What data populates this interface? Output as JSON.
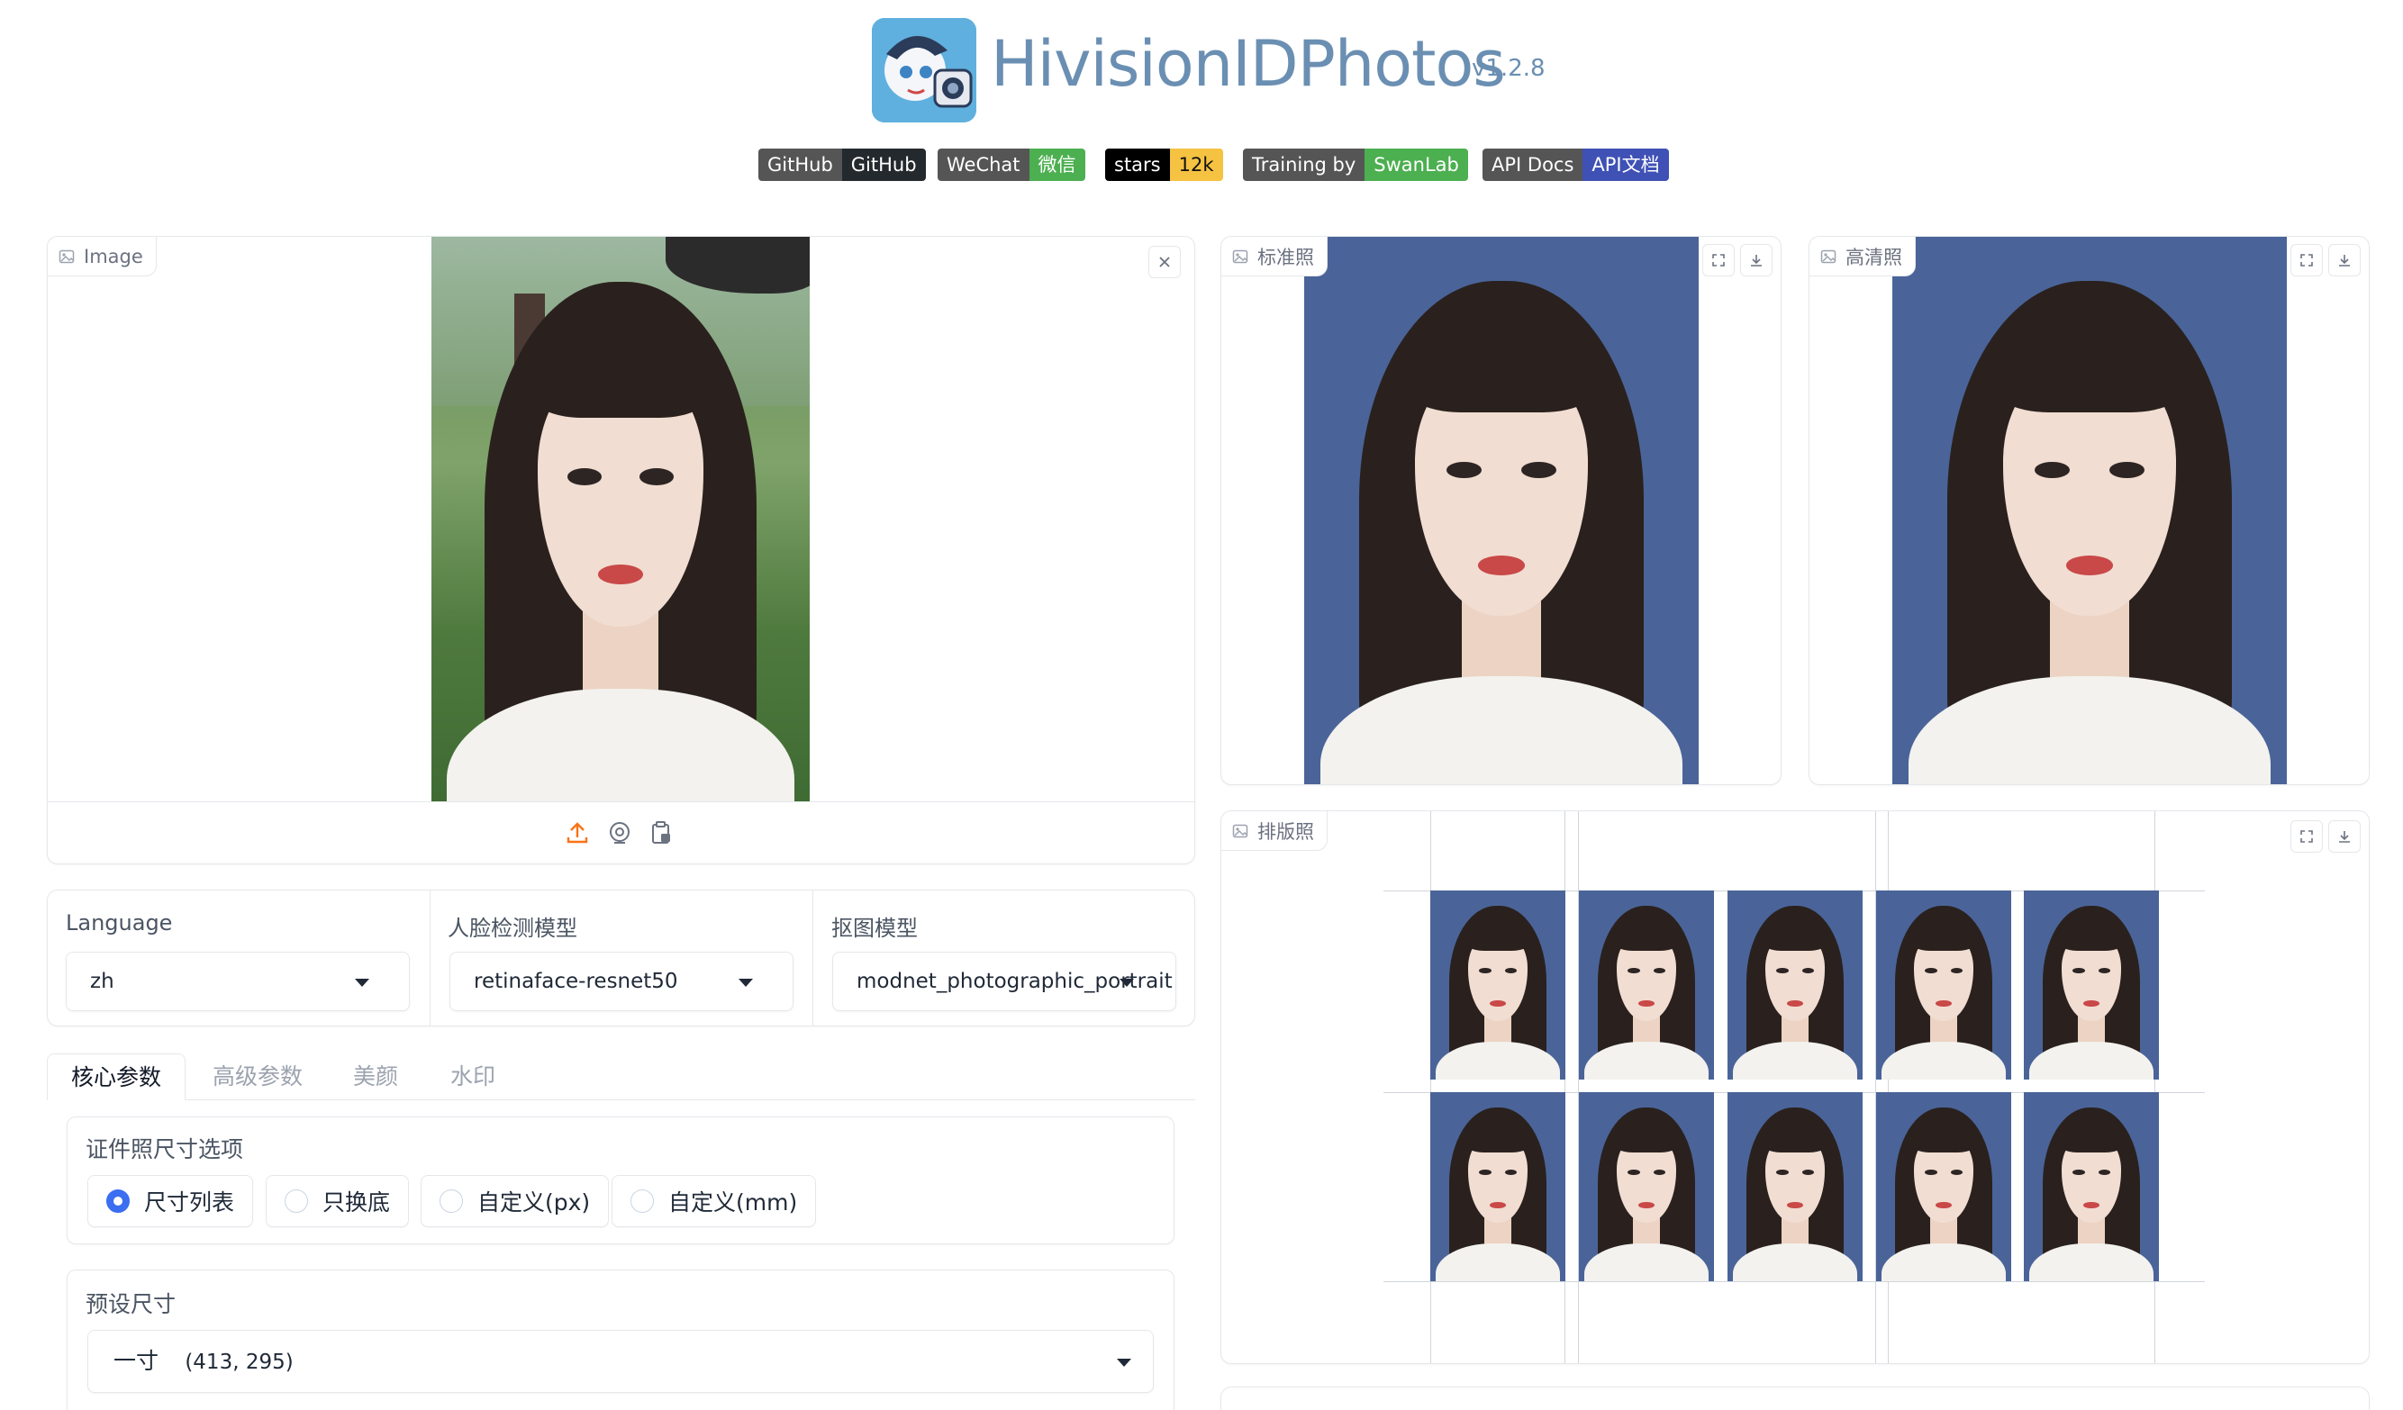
{
  "header": {
    "app_title": "HivisionIDPhotos",
    "app_version": "v1.2.8"
  },
  "badges": [
    {
      "left": "GitHub",
      "right": "GitHub",
      "left_color": "#555555",
      "right_color": "#24292e"
    },
    {
      "left": "WeChat",
      "right": "微信",
      "left_color": "#555555",
      "right_color": "#4caf50"
    },
    {
      "left": "stars",
      "right": "12k",
      "left_color": "#000000",
      "right_color": "#f5c242"
    },
    {
      "left": "Training by",
      "right": "SwanLab",
      "left_color": "#555555",
      "right_color": "#4caf50"
    },
    {
      "left": "API Docs",
      "right": "API文档",
      "left_color": "#555555",
      "right_color": "#3f51b5"
    }
  ],
  "input_panel": {
    "label": "Image"
  },
  "output_panels": {
    "standard_label": "标准照",
    "hd_label": "高清照",
    "layout_label": "排版照"
  },
  "selectors": {
    "language": {
      "label": "Language",
      "value": "zh"
    },
    "face_model": {
      "label": "人脸检测模型",
      "value": "retinaface-resnet50"
    },
    "matting_model": {
      "label": "抠图模型",
      "value": "modnet_photographic_portrait"
    }
  },
  "tabs": [
    "核心参数",
    "高级参数",
    "美颜",
    "水印"
  ],
  "size_options": {
    "label": "证件照尺寸选项",
    "options": [
      "尺寸列表",
      "只换底",
      "自定义(px)",
      "自定义(mm)"
    ],
    "selected": "尺寸列表"
  },
  "preset_size": {
    "label": "预设尺寸",
    "value_name": "一寸",
    "value_dims": "(413, 295)"
  },
  "colors": {
    "accent": "#3b6ef0",
    "id_photo_background": "#4a6499",
    "upload_icon": "#f97316"
  }
}
